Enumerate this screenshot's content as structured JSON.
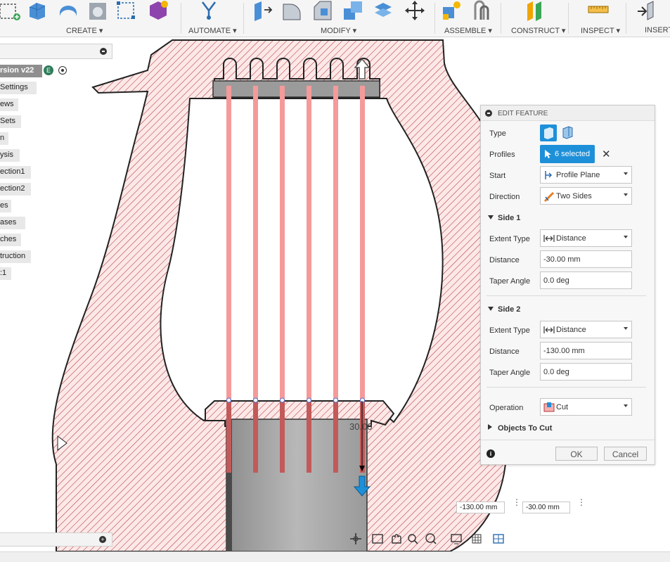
{
  "toolbar": {
    "groups": [
      {
        "label": "CREATE ▾"
      },
      {
        "label": "AUTOMATE ▾"
      },
      {
        "label": "MODIFY ▾"
      },
      {
        "label": "ASSEMBLE ▾"
      },
      {
        "label": "CONSTRUCT ▾"
      },
      {
        "label": "INSPECT ▾"
      },
      {
        "label": "INSERT"
      }
    ]
  },
  "browser": {
    "root_label": "rsion v22",
    "items": [
      {
        "label": "Settings"
      },
      {
        "label": "ews"
      },
      {
        "label": "Sets"
      },
      {
        "label": "n"
      },
      {
        "label": "ysis"
      },
      {
        "label": "ection1"
      },
      {
        "label": "ection2"
      },
      {
        "label": "es"
      },
      {
        "label": "ases"
      },
      {
        "label": "ches"
      },
      {
        "label": "truction"
      },
      {
        "label": ":1"
      }
    ]
  },
  "viewport": {
    "dimension_label": "30.00"
  },
  "edit_feature": {
    "title": "EDIT FEATURE",
    "type_label": "Type",
    "profiles_label": "Profiles",
    "profiles_value": "6 selected",
    "start_label": "Start",
    "start_value": "Profile Plane",
    "direction_label": "Direction",
    "direction_value": "Two Sides",
    "side1": {
      "title": "Side 1",
      "extent_type_label": "Extent Type",
      "extent_type_value": "Distance",
      "distance_label": "Distance",
      "distance_value": "-30.00 mm",
      "taper_label": "Taper Angle",
      "taper_value": "0.0 deg"
    },
    "side2": {
      "title": "Side 2",
      "extent_type_label": "Extent Type",
      "extent_type_value": "Distance",
      "distance_label": "Distance",
      "distance_value": "-130.00 mm",
      "taper_label": "Taper Angle",
      "taper_value": "0.0 deg"
    },
    "operation_label": "Operation",
    "operation_value": "Cut",
    "objects_to_cut_label": "Objects To Cut",
    "ok_label": "OK",
    "cancel_label": "Cancel"
  },
  "readouts": {
    "side2_value": "-130.00 mm",
    "side1_value": "-30.00 mm"
  },
  "colors": {
    "accent": "#0696d7",
    "hatch": "#c0392b",
    "fill_pink": "#fbe4e4",
    "profile_red": "#f08080"
  }
}
